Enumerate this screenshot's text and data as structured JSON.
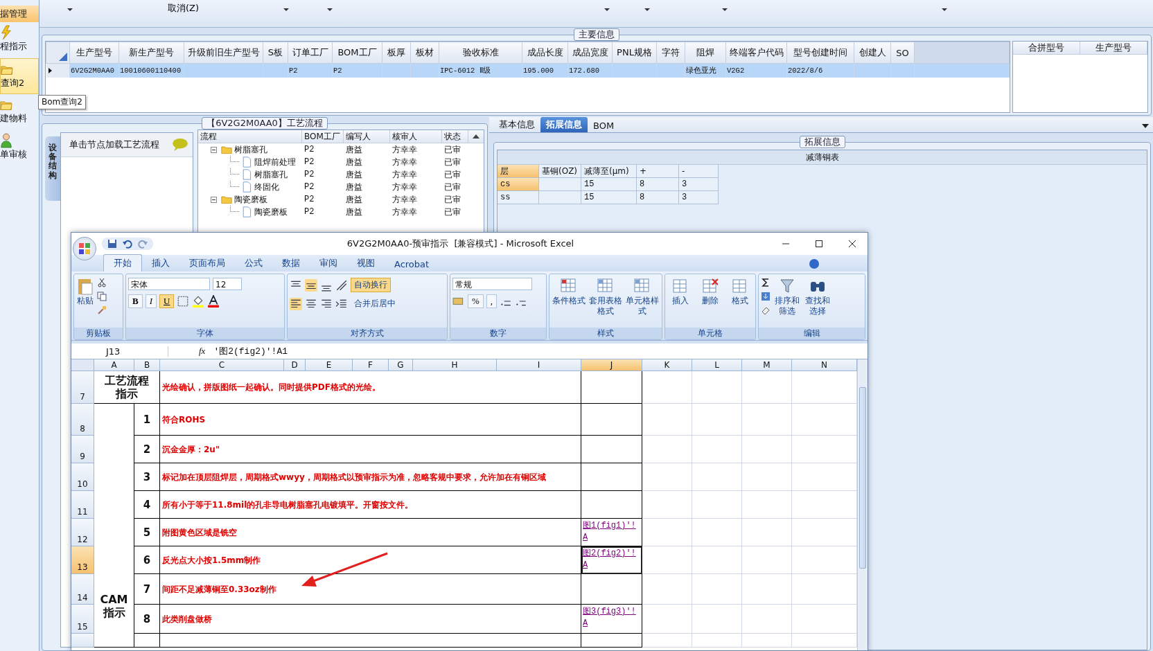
{
  "sidebar": {
    "items": [
      {
        "kind": "header",
        "label": "据管理",
        "selected": true
      },
      {
        "kind": "bolt",
        "label": "程指示",
        "selected": false
      },
      {
        "kind": "folder",
        "label": "查询2",
        "selected": true
      },
      {
        "kind": "folder",
        "label": "建物料",
        "selected": false
      },
      {
        "kind": "person",
        "label": "单审核",
        "selected": false
      }
    ],
    "tooltip": "Bom查询2"
  },
  "toolbar": {
    "button": "取消(Z)"
  },
  "main_info": {
    "title": "主要信息",
    "columns": [
      "生产型号",
      "新生产型号",
      "升级前旧生产型号",
      "S板",
      "订单工厂",
      "BOM工厂",
      "板厚",
      "板材",
      "验收标准",
      "成品长度",
      "成品宽度",
      "PNL规格",
      "字符",
      "阻焊",
      "终端客户代码",
      "型号创建时间",
      "创建人",
      "SO"
    ],
    "rows": [
      {
        "selected": true,
        "cells": [
          "6V2G2M0AA0",
          "10010600110400",
          null,
          null,
          "P2",
          "P2",
          null,
          null,
          "IPC-6012 Ⅱ级",
          "195.000",
          "172.680",
          null,
          null,
          "绿色亚光",
          "V2G2",
          "2022/8/6",
          null,
          null
        ]
      }
    ],
    "side_columns": [
      "合拼型号",
      "生产型号"
    ]
  },
  "process": {
    "title": "【6V2G2M0AA0】工艺流程",
    "side_tab": "设备结构",
    "hint": "单击节点加载工艺流程",
    "columns": [
      "流程",
      "BOM工厂",
      "编写人",
      "核审人",
      "状态"
    ],
    "tree": [
      {
        "kind": "folder",
        "label": "树脂塞孔",
        "expanded": true,
        "bom": "P2",
        "writer": "唐益",
        "reviewer": "方幸幸",
        "status": "已审",
        "children": [
          {
            "kind": "doc",
            "label": "阻焊前处理",
            "bom": "P2",
            "writer": "唐益",
            "reviewer": "方幸幸",
            "status": "已审"
          },
          {
            "kind": "doc",
            "label": "树脂塞孔",
            "bom": "P2",
            "writer": "唐益",
            "reviewer": "方幸幸",
            "status": "已审"
          },
          {
            "kind": "doc",
            "label": "终固化",
            "bom": "P2",
            "writer": "唐益",
            "reviewer": "方幸幸",
            "status": "已审"
          }
        ]
      },
      {
        "kind": "folder",
        "label": "陶瓷磨板",
        "expanded": true,
        "bom": "P2",
        "writer": "唐益",
        "reviewer": "方幸幸",
        "status": "已审",
        "children": [
          {
            "kind": "doc",
            "label": "陶瓷磨板",
            "bom": "P2",
            "writer": "唐益",
            "reviewer": "方幸幸",
            "status": "已审"
          }
        ]
      }
    ]
  },
  "details": {
    "tabs": [
      {
        "label": "基本信息",
        "selected": false
      },
      {
        "label": "拓展信息",
        "selected": true
      },
      {
        "label": "BOM",
        "selected": false
      }
    ],
    "group_title": "拓展信息",
    "table": {
      "title": "减薄铜表",
      "columns": [
        {
          "label": "层",
          "selected": true
        },
        {
          "label": "基铜(OZ)",
          "selected": false
        },
        {
          "label": "减薄至(μm)",
          "selected": false
        },
        {
          "label": "+",
          "selected": false
        },
        {
          "label": "-",
          "selected": false
        }
      ],
      "rows": [
        {
          "selected": true,
          "cells": [
            "cs",
            null,
            "15",
            "8",
            "3"
          ]
        },
        {
          "selected": false,
          "cells": [
            "ss",
            null,
            "15",
            "8",
            "3"
          ]
        }
      ]
    }
  },
  "excel": {
    "title": "6V2G2M0AA0-预审指示  [兼容模式] - Microsoft Excel",
    "tabs": [
      {
        "label": "开始",
        "selected": true
      },
      {
        "label": "插入",
        "selected": false
      },
      {
        "label": "页面布局",
        "selected": false
      },
      {
        "label": "公式",
        "selected": false
      },
      {
        "label": "数据",
        "selected": false
      },
      {
        "label": "审阅",
        "selected": false
      },
      {
        "label": "视图",
        "selected": false
      },
      {
        "label": "Acrobat",
        "selected": false
      }
    ],
    "ribbon": {
      "paste": "粘贴",
      "font": "宋体",
      "size": "12",
      "styles": [
        {
          "label": "B",
          "on": false
        },
        {
          "label": "I",
          "on": false
        },
        {
          "label": "U",
          "on": true
        }
      ],
      "wrap": {
        "label": "自动换行",
        "on": true
      },
      "merge": "合并后居中",
      "format": "常规",
      "symbols": [
        "%",
        ","
      ],
      "style_buttons": [
        "条件格式",
        "套用表格格式",
        "单元格样式"
      ],
      "cell_buttons": [
        "插入",
        "删除",
        "格式"
      ],
      "edit_buttons": [
        "排序和筛选",
        "查找和选择"
      ],
      "groups": [
        "剪贴板",
        "字体",
        "对齐方式",
        "数字",
        "样式",
        "单元格",
        "编辑"
      ]
    },
    "name_box": "J13",
    "fx_label": "fx",
    "formula": "'图2(fig2)'!A1",
    "columns": [
      {
        "label": "A",
        "selected": false
      },
      {
        "label": "B",
        "selected": false
      },
      {
        "label": "C",
        "selected": false
      },
      {
        "label": "D",
        "selected": false
      },
      {
        "label": "E",
        "selected": false
      },
      {
        "label": "F",
        "selected": false
      },
      {
        "label": "G",
        "selected": false
      },
      {
        "label": "H",
        "selected": false
      },
      {
        "label": "I",
        "selected": false
      },
      {
        "label": "J",
        "selected": true
      },
      {
        "label": "K",
        "selected": false
      },
      {
        "label": "L",
        "selected": false
      },
      {
        "label": "M",
        "selected": false
      },
      {
        "label": "N",
        "selected": false
      }
    ],
    "row_headers": [
      {
        "label": "7",
        "selected": false
      },
      {
        "label": "8",
        "selected": false
      },
      {
        "label": "9",
        "selected": false
      },
      {
        "label": "10",
        "selected": false
      },
      {
        "label": "11",
        "selected": false
      },
      {
        "label": "12",
        "selected": false
      },
      {
        "label": "13",
        "selected": true
      },
      {
        "label": "14",
        "selected": false
      },
      {
        "label": "15",
        "selected": false
      }
    ],
    "side_label": "CAM指示",
    "rows": [
      {
        "kind": "heading",
        "label": "工艺流程指示",
        "text": "光绘确认，拼版图纸一起确认。同时提供PDF格式的光绘。"
      },
      {
        "kind": "item",
        "number": "1",
        "text": "符合ROHS"
      },
      {
        "kind": "item",
        "number": "2",
        "text": "沉金金厚：2u\""
      },
      {
        "kind": "item",
        "number": "3",
        "text": "标记加在顶层阻焊层，周期格式wwyy，周期格式以预审指示为准，忽略客规中要求，允许加在有铜区域"
      },
      {
        "kind": "item",
        "number": "4",
        "text": "所有小于等于11.8mil的孔非导电树脂塞孔电镀填平。开窗按文件。"
      },
      {
        "kind": "item",
        "number": "5",
        "text": "附图黄色区域是铣空",
        "link": {
          "text": "图1(fig1)'!A",
          "selected": false
        }
      },
      {
        "kind": "item",
        "number": "6",
        "text": "反光点大小按1.5mm制作",
        "link": {
          "text": "图2(fig2)'!A",
          "selected": true
        }
      },
      {
        "kind": "item",
        "number": "7",
        "text": "间距不足减薄铜至0.33oz制作"
      },
      {
        "kind": "item",
        "number": "8",
        "text": "此类削盘做桥",
        "link": {
          "text": "图3(fig3)'!A",
          "selected": false
        }
      }
    ]
  }
}
